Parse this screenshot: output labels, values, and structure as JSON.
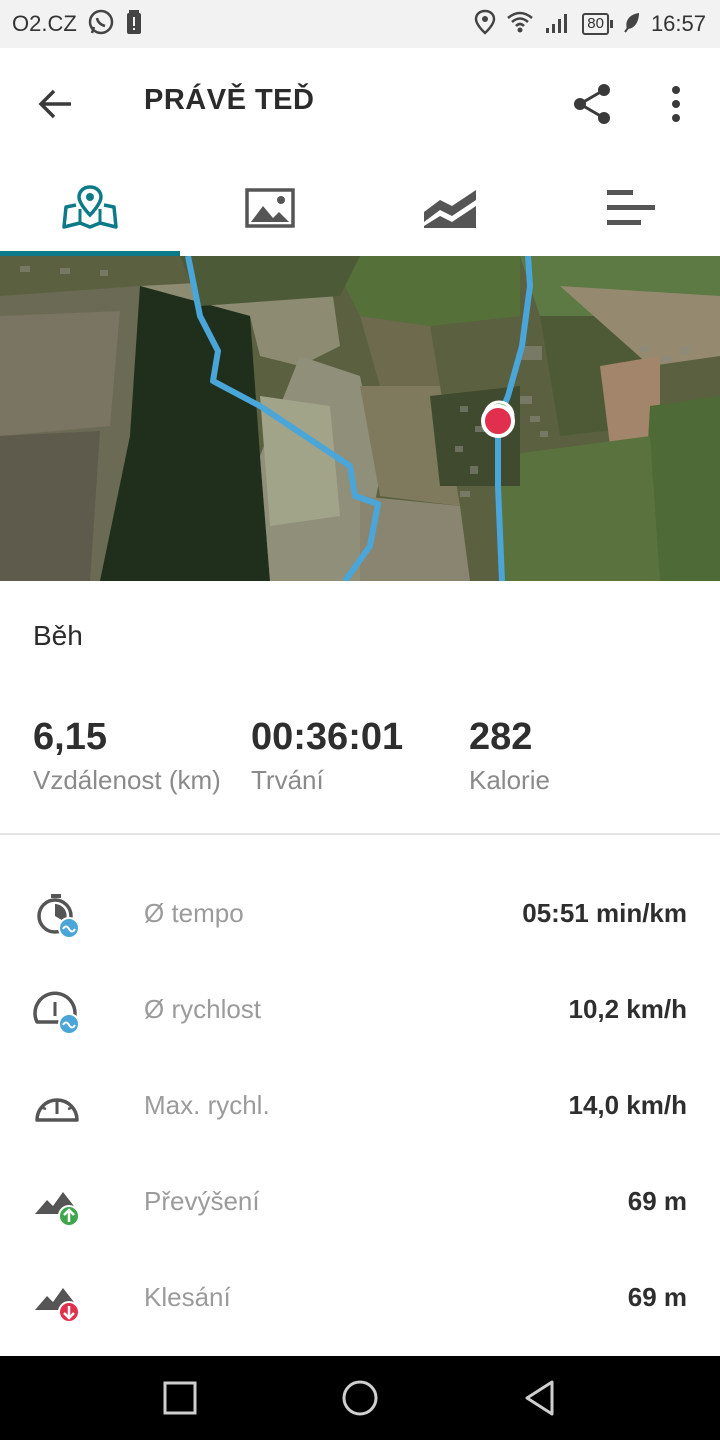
{
  "status_bar": {
    "carrier": "O2.CZ",
    "battery": "80",
    "time": "16:57",
    "icons": [
      "whatsapp-icon",
      "battery-alert-icon",
      "location-icon",
      "wifi-icon",
      "signal-icon",
      "battery-icon",
      "leaf-icon"
    ]
  },
  "header": {
    "title": "PRÁVĚ TEĎ",
    "icons": [
      "back-arrow-icon",
      "share-icon",
      "more-vert-icon"
    ]
  },
  "tabs": [
    {
      "icon": "map-icon",
      "selected": true
    },
    {
      "icon": "photo-icon",
      "selected": false
    },
    {
      "icon": "chart-icon",
      "selected": false
    },
    {
      "icon": "bars-icon",
      "selected": false
    }
  ],
  "colors": {
    "accent": "#0d7a88",
    "route": "#4aa6d8",
    "marker": "#e0304e",
    "up": "#3ea64a",
    "down": "#e0304e"
  },
  "summary": {
    "activity": "Běh",
    "distance": {
      "value": "6,15",
      "label": "Vzdálenost (km)"
    },
    "duration": {
      "value": "00:36:01",
      "label": "Trvání"
    },
    "calories": {
      "value": "282",
      "label": "Kalorie"
    }
  },
  "details": [
    {
      "icon": "stopwatch-avg-icon",
      "label": "Ø tempo",
      "value": "05:51 min/km"
    },
    {
      "icon": "speedometer-avg-icon",
      "label": "Ø rychlost",
      "value": "10,2 km/h"
    },
    {
      "icon": "speedometer-icon",
      "label": "Max. rychl.",
      "value": "14,0 km/h"
    },
    {
      "icon": "ascent-icon",
      "label": "Převýšení",
      "value": "69 m"
    },
    {
      "icon": "descent-icon",
      "label": "Klesání",
      "value": "69 m"
    }
  ],
  "nav_bar": {
    "icons": [
      "recents-icon",
      "home-icon",
      "back-icon"
    ]
  }
}
